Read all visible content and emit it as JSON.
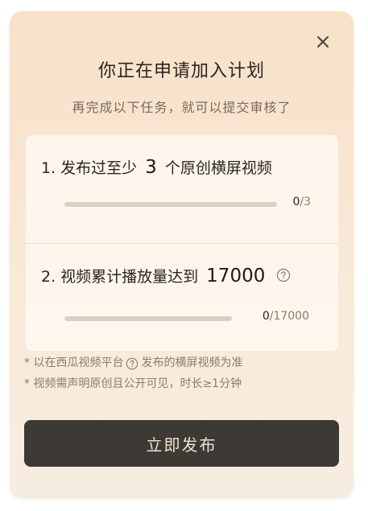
{
  "dialog": {
    "title": "你正在申请加入计划",
    "subtitle": "再完成以下任务，就可以提交审核了",
    "close_icon": "close-icon"
  },
  "tasks": [
    {
      "prefix": "1. 发布过至少",
      "count": "3",
      "suffix": "个原创横屏视频",
      "progress_current": "0",
      "progress_total": "/3",
      "progress_fraction": 0
    },
    {
      "prefix": "2. 视频累计播放量达到",
      "count": "17000",
      "suffix": "",
      "help_icon": "question-circle-icon",
      "progress_current": "0",
      "progress_total": "/17000",
      "progress_fraction": 0
    }
  ],
  "notes": {
    "line1_before": "* 以在西瓜视频平台",
    "line1_after": "发布的横屏视频为准",
    "line2": "* 视频需声明原创且公开可见，时长≥1分钟",
    "help_icon": "question-circle-icon"
  },
  "publish_button": {
    "label": "立即发布"
  },
  "colors": {
    "button_bg": "#3d3935",
    "button_text": "#f1e3cf",
    "card_gradient_top": "#f7e1c8",
    "progress_track": "#d8cfc5"
  }
}
